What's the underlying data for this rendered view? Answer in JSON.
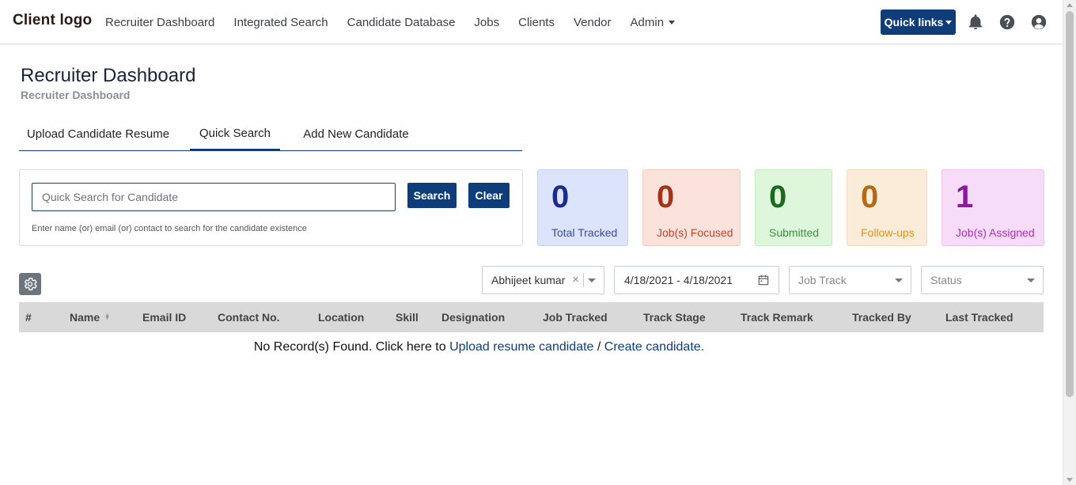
{
  "navbar": {
    "logo": "Client logo",
    "links": [
      "Recruiter Dashboard",
      "Integrated Search",
      "Candidate Database",
      "Jobs",
      "Clients",
      "Vendor",
      "Admin"
    ],
    "quick_links": "Quick links"
  },
  "header": {
    "title": "Recruiter Dashboard",
    "breadcrumb": "Recruiter Dashboard"
  },
  "tabs": [
    {
      "label": "Upload Candidate Resume",
      "active": false
    },
    {
      "label": "Quick Search",
      "active": true
    },
    {
      "label": "Add New Candidate",
      "active": false
    }
  ],
  "search": {
    "placeholder": "Quick Search for Candidate",
    "search_button": "Search",
    "clear_button": "Clear",
    "hint": "Enter name (or) email (or) contact to search for the candidate existence"
  },
  "stats": [
    {
      "value": "0",
      "label": "Total Tracked",
      "color": "#1b2a8c",
      "label_color": "#3b4a9c",
      "bg": "#dce4fb",
      "border": "#c5d1f5"
    },
    {
      "value": "0",
      "label": "Job(s) Focused",
      "color": "#a3341b",
      "label_color": "#c0452a",
      "bg": "#fbe3dc",
      "border": "#f3cdbf"
    },
    {
      "value": "0",
      "label": "Submitted",
      "color": "#1b6b1f",
      "label_color": "#3a913e",
      "bg": "#def7dc",
      "border": "#c4edc2"
    },
    {
      "value": "0",
      "label": "Follow-ups",
      "color": "#b46a12",
      "label_color": "#e4931c",
      "bg": "#fbecda",
      "border": "#f3dcbf"
    },
    {
      "value": "1",
      "label": "Job(s) Assigned",
      "color": "#8e1a9a",
      "label_color": "#b02bbd",
      "bg": "#f7dcf9",
      "border": "#ecc2f0"
    }
  ],
  "filters": {
    "recruiter": "Abhijeet kumar",
    "date_range": "4/18/2021 - 4/18/2021",
    "job_track_placeholder": "Job Track",
    "status_placeholder": "Status"
  },
  "table": {
    "columns": [
      "#",
      "Name",
      "Email ID",
      "Contact No.",
      "Location",
      "Skill",
      "Designation",
      "Job Tracked",
      "Track Stage",
      "Track Remark",
      "Tracked By",
      "Last Tracked"
    ],
    "empty_text": "No Record(s) Found. Click here to",
    "upload_link": "Upload resume candidate",
    "separator": "/",
    "create_link": "Create candidate."
  }
}
